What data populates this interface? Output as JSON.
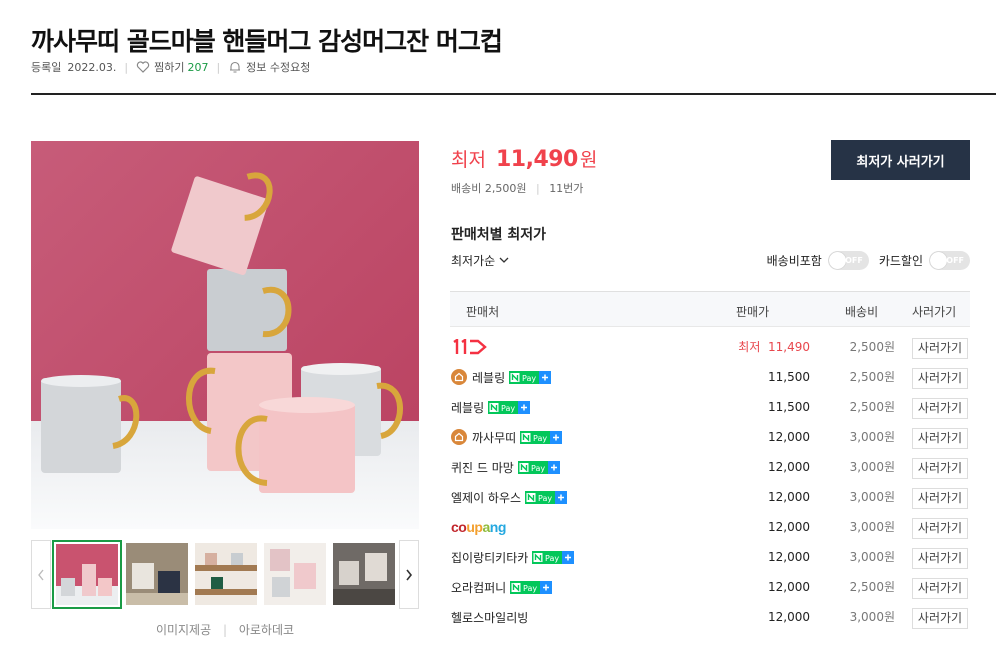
{
  "product": {
    "title": "까사무띠 골드마블 핸들머그 감성머그잔 머그컵",
    "registered_label": "등록일",
    "registered_date": "2022.03.",
    "wish_label": "찜하기",
    "wish_count": "207",
    "report_label": "정보 수정요청"
  },
  "gallery": {
    "thumbnails": [
      "thumb-1",
      "thumb-2",
      "thumb-3",
      "thumb-4",
      "thumb-5"
    ],
    "active_index": 0,
    "credit_label": "이미지제공",
    "credit_source": "아로하데코"
  },
  "price": {
    "lowest_label": "최저",
    "amount": "11,490",
    "unit": "원",
    "shipping": "배송비 2,500원",
    "mall": "11번가",
    "buy_button": "최저가 사러가기"
  },
  "sellers": {
    "title": "판매처별 최저가",
    "sort_label": "최저가순",
    "toggle_shipping": "배송비포함",
    "toggle_card": "카드할인",
    "toggle_off_text": "OFF",
    "columns": [
      "판매처",
      "판매가",
      "배송비",
      "사러가기"
    ],
    "buy_label": "사러가기",
    "npay_text": "Pay",
    "rows": [
      {
        "name": "",
        "logo": "11st",
        "shop_icon": false,
        "npay": false,
        "price": "최저  11,490",
        "lowest": true,
        "ship": "2,500원"
      },
      {
        "name": "레블링",
        "logo": "",
        "shop_icon": true,
        "npay": true,
        "price": "11,500",
        "lowest": false,
        "ship": "2,500원"
      },
      {
        "name": "레블링",
        "logo": "",
        "shop_icon": false,
        "npay": true,
        "price": "11,500",
        "lowest": false,
        "ship": "2,500원"
      },
      {
        "name": "까사무띠",
        "logo": "",
        "shop_icon": true,
        "npay": true,
        "price": "12,000",
        "lowest": false,
        "ship": "3,000원"
      },
      {
        "name": "퀴진 드 마망",
        "logo": "",
        "shop_icon": false,
        "npay": true,
        "price": "12,000",
        "lowest": false,
        "ship": "3,000원"
      },
      {
        "name": "엘제이 하우스",
        "logo": "",
        "shop_icon": false,
        "npay": true,
        "price": "12,000",
        "lowest": false,
        "ship": "3,000원"
      },
      {
        "name": "coupang",
        "logo": "coupang",
        "shop_icon": false,
        "npay": false,
        "price": "12,000",
        "lowest": false,
        "ship": "3,000원"
      },
      {
        "name": "집이랑티키타카",
        "logo": "",
        "shop_icon": false,
        "npay": true,
        "price": "12,000",
        "lowest": false,
        "ship": "3,000원"
      },
      {
        "name": "오라컴퍼니",
        "logo": "",
        "shop_icon": false,
        "npay": true,
        "price": "12,000",
        "lowest": false,
        "ship": "2,500원"
      },
      {
        "name": "헬로스마일리빙",
        "logo": "",
        "shop_icon": false,
        "npay": false,
        "price": "12,000",
        "lowest": false,
        "ship": "3,000원"
      }
    ]
  },
  "colors": {
    "accent_red": "#f0424c",
    "button_navy": "#263346",
    "npay_green": "#03c75a",
    "active_green": "#1a9b45"
  }
}
